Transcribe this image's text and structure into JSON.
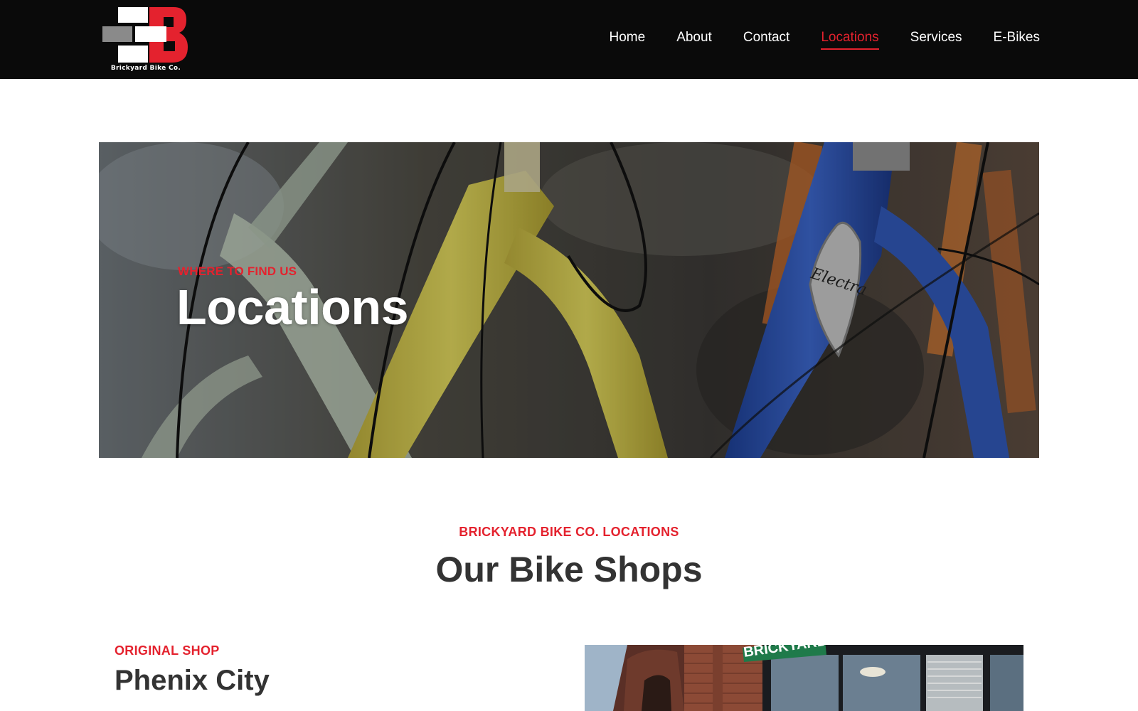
{
  "header": {
    "logo_text": "Brickyard Bike Co.",
    "logo_icon": "brickyard-b-logo",
    "nav": [
      {
        "label": "Home",
        "active": false
      },
      {
        "label": "About",
        "active": false
      },
      {
        "label": "Contact",
        "active": false
      },
      {
        "label": "Locations",
        "active": true
      },
      {
        "label": "Services",
        "active": false
      },
      {
        "label": "E-Bikes",
        "active": false
      }
    ]
  },
  "hero": {
    "eyebrow": "WHERE TO FIND US",
    "title": "Locations"
  },
  "section": {
    "eyebrow": "BRICKYARD BIKE CO. LOCATIONS",
    "title": "Our Bike Shops"
  },
  "locations": [
    {
      "eyebrow": "ORIGINAL SHOP",
      "title": "Phenix City",
      "sign_text": "BRICKYARD RD"
    }
  ],
  "colors": {
    "accent": "#e4222e",
    "header_bg": "#0a0a0a",
    "text": "#333333"
  }
}
